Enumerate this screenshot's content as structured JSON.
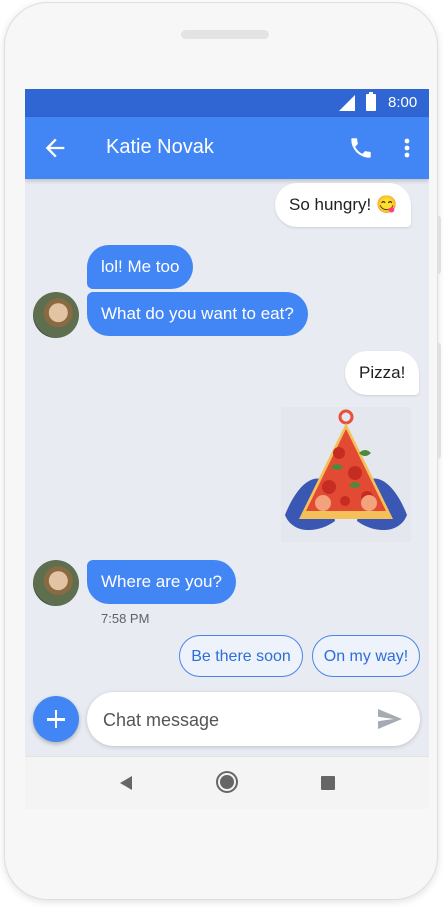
{
  "status_bar": {
    "time": "8:00"
  },
  "header": {
    "contact_name": "Katie Novak"
  },
  "messages": [
    {
      "direction": "outgoing",
      "text": "So hungry! 😋"
    },
    {
      "direction": "incoming",
      "text": "lol! Me too"
    },
    {
      "direction": "incoming",
      "text": "What do you want to eat?"
    },
    {
      "direction": "outgoing",
      "text": "Pizza!"
    },
    {
      "direction": "outgoing",
      "type": "sticker",
      "sticker": "pizza-slice-sticker"
    },
    {
      "direction": "incoming",
      "text": "Where are you?",
      "timestamp": "7:58 PM"
    }
  ],
  "smart_replies": [
    "Be there soon",
    "On my way!"
  ],
  "composer": {
    "placeholder": "Chat message"
  },
  "icons": {
    "back": "arrow-left-icon",
    "call": "phone-icon",
    "more": "more-vert-icon",
    "add": "plus-icon",
    "send": "send-icon"
  },
  "colors": {
    "status_bar": "#2f66d3",
    "app_bar": "#4285f4",
    "incoming_bubble": "#4285f4",
    "outgoing_bubble": "#ffffff",
    "chat_background": "#e8ebf1"
  }
}
